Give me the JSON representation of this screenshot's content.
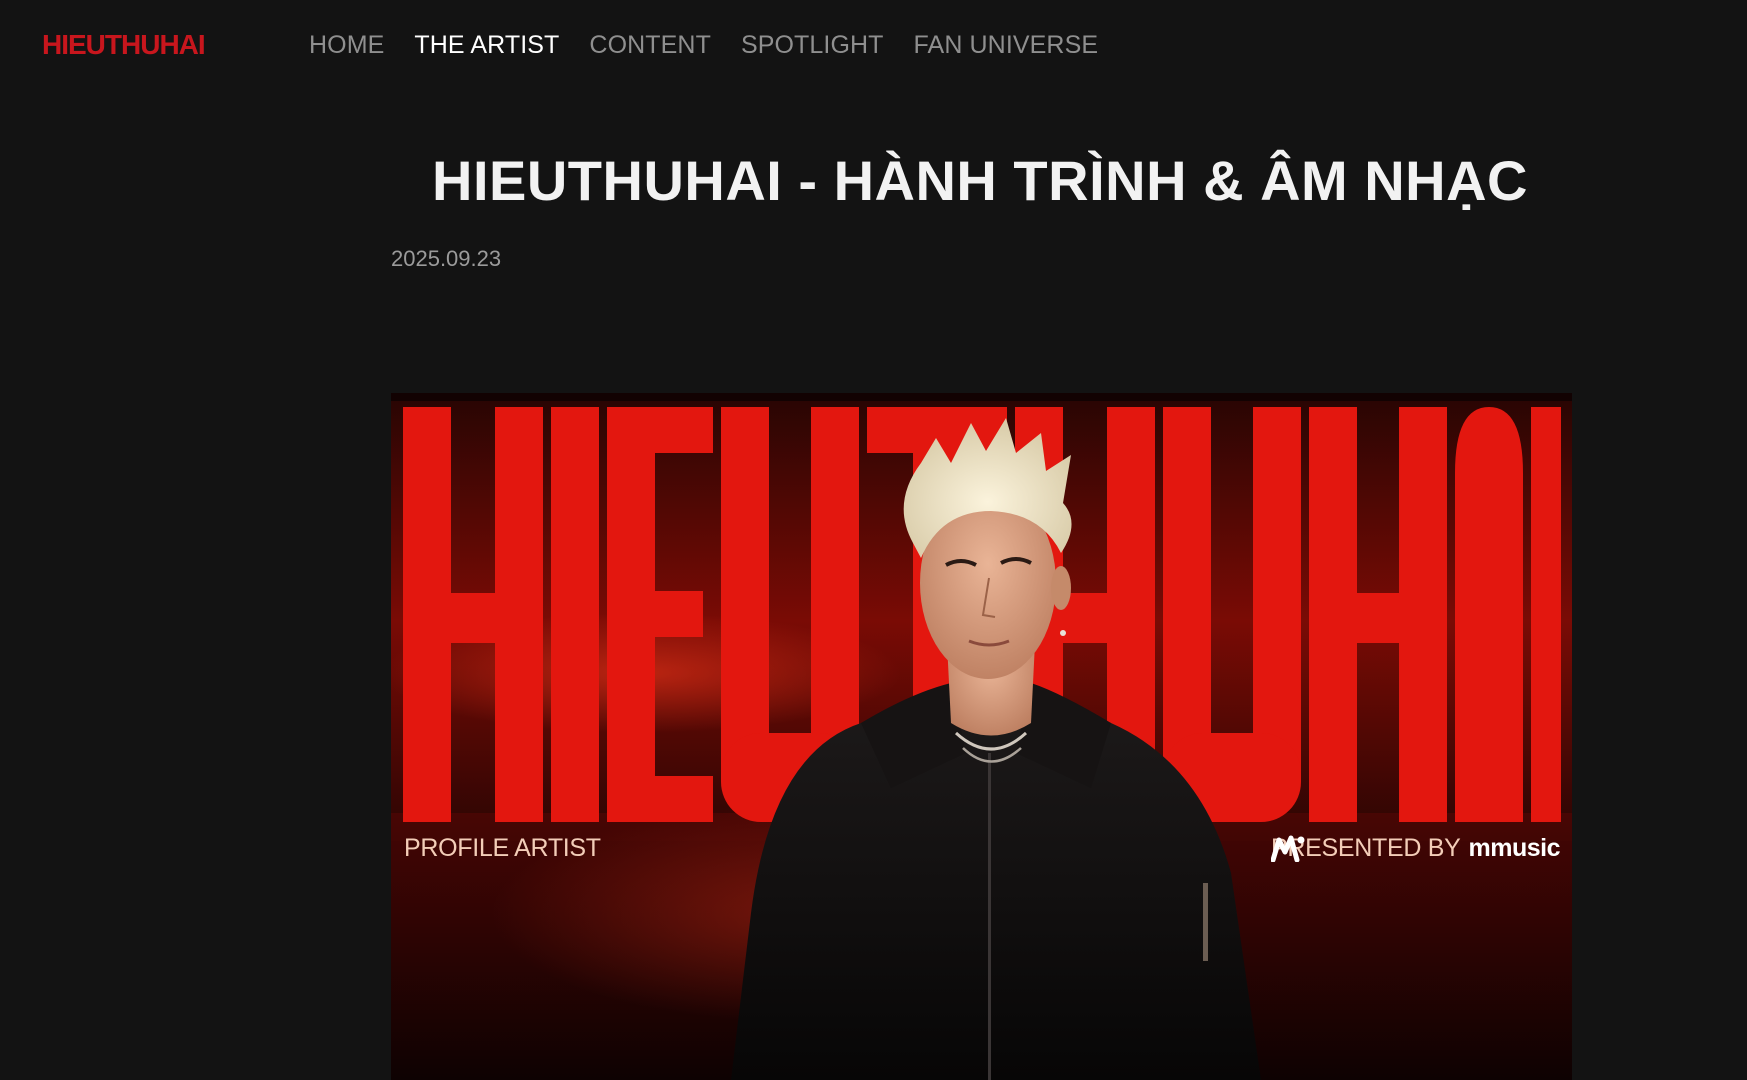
{
  "header": {
    "logo": "HIEUTHUHAI",
    "nav": [
      "HOME",
      "THE ARTIST",
      "CONTENT",
      "SPOTLIGHT",
      "FAN UNIVERSE"
    ],
    "active_nav": "THE ARTIST"
  },
  "article": {
    "title": "HIEUTHUHAI - HÀNH TRÌNH & ÂM NHẠC",
    "date": "2025.09.23"
  },
  "hero": {
    "big_text": "HIEUTHUHAI",
    "label_left": "PROFILE ARTIST",
    "presented_by": "PRESENTED BY",
    "brand": "mmusic"
  },
  "colors": {
    "background": "#131313",
    "brand_red": "#c8161d",
    "hero_red": "#e3170f",
    "nav_inactive": "#8f8f8f",
    "nav_active": "#ffffff"
  }
}
